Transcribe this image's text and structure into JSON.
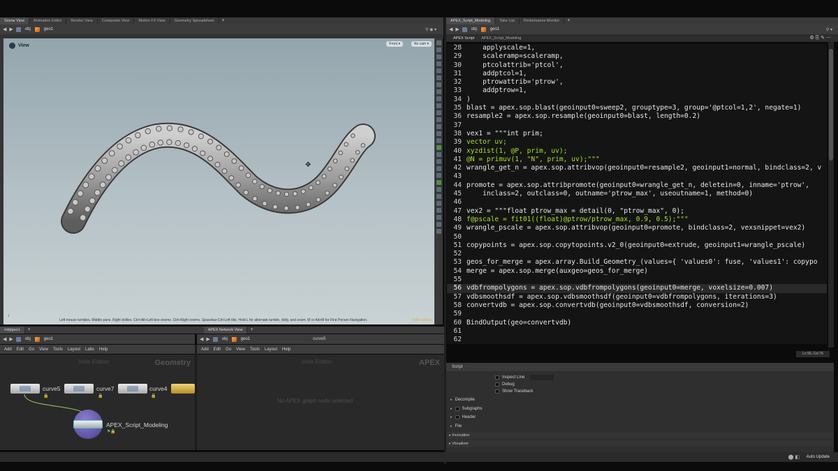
{
  "left_panes": {
    "tabs": [
      "Scene View",
      "Animation Editor",
      "Render View",
      "Composite View",
      "Motion FX View",
      "Geometry Spreadsheet"
    ],
    "path": [
      "obj",
      "geo1"
    ]
  },
  "viewport": {
    "title": "View",
    "persp": "Front",
    "cam": "No cam",
    "help": "Left mouse tumbles. Middle pans. Right dollies. Ctrl+Alt+Left box-zooms. Ctrl+Right zooms. Spacebar-Ctrl-Left tilts. Hold L for alternate tumble, dolly, and zoom. M or Alt+M for First Person Navigation.",
    "edition": "Indie Edition"
  },
  "right_panes": {
    "tabs": [
      "APEX_Script_Modeling",
      "Take List",
      "Performance Monitor"
    ],
    "path": [
      "obj",
      "geo1"
    ],
    "sub_tabs": [
      "APEX Script",
      "APEX_Script_Modeling"
    ],
    "cursor_pos": "Ln 56, Col 76"
  },
  "code": [
    {
      "n": "28",
      "t": "    applyscale=1,"
    },
    {
      "n": "29",
      "t": "    scaleramp=scaleramp,"
    },
    {
      "n": "30",
      "t": "    ptcolattrib='ptcol',"
    },
    {
      "n": "31",
      "t": "    addptcol=1,"
    },
    {
      "n": "32",
      "t": "    ptrowattrib='ptrow',"
    },
    {
      "n": "33",
      "t": "    addptrow=1,"
    },
    {
      "n": "34",
      "t": ")"
    },
    {
      "n": "35",
      "t": "blast = apex.sop.blast(geoinput0=sweep2, grouptype=3, group='@ptcol=1,2', negate=1)"
    },
    {
      "n": "36",
      "t": "resample2 = apex.sop.resample(geoinput0=blast, length=0.2)"
    },
    {
      "n": "37",
      "t": ""
    },
    {
      "n": "38",
      "t": "vex1 = \"\"\"int prim;"
    },
    {
      "n": "39",
      "t": "vector uv;"
    },
    {
      "n": "40",
      "t": "xyzdist(1, @P, prim, uv);"
    },
    {
      "n": "41",
      "t": "@N = primuv(1, \"N\", prim, uv);\"\"\""
    },
    {
      "n": "42",
      "t": "wrangle_get_n = apex.sop.attribvop(geoinput0=resample2, geoinput1=normal, bindclass=2, v"
    },
    {
      "n": "43",
      "t": ""
    },
    {
      "n": "44",
      "t": "promote = apex.sop.attribpromote(geoinput0=wrangle_get_n, deletein=0, inname='ptrow',"
    },
    {
      "n": "45",
      "t": "    inclass=2, outclass=0, outname='ptrow_max', useoutname=1, method=0)"
    },
    {
      "n": "46",
      "t": ""
    },
    {
      "n": "47",
      "t": "vex2 = \"\"\"float ptrow_max = detail(0, \"ptrow_max\", 0);"
    },
    {
      "n": "48",
      "t": "f@pscale = fit01((float)@ptrow/ptrow_max, 0.9, 0.5);\"\"\""
    },
    {
      "n": "49",
      "t": "wrangle_pscale = apex.sop.attribvop(geoinput0=promote, bindclass=2, vexsnippet=vex2)"
    },
    {
      "n": "50",
      "t": ""
    },
    {
      "n": "51",
      "t": "copypoints = apex.sop.copytopoints.v2_0(geoinput0=extrude, geoinput1=wrangle_pscale)"
    },
    {
      "n": "52",
      "t": ""
    },
    {
      "n": "53",
      "t": "geos_for_merge = apex.array.Build_Geometry_(values={ 'values0': fuse, 'values1': copypo"
    },
    {
      "n": "54",
      "t": "merge = apex.sop.merge(auxgeo=geos_for_merge)"
    },
    {
      "n": "55",
      "t": ""
    },
    {
      "n": "56",
      "t": "vdbfrompolygons = apex.sop.vdbfrompolygons(geoinput0=merge, voxelsize=0.007)"
    },
    {
      "n": "57",
      "t": "vdbsmoothsdf = apex.sop.vdbsmoothsdf(geoinput0=vdbfrompolygons, iterations=3)"
    },
    {
      "n": "58",
      "t": "convertvdb = apex.sop.convertvdb(geoinput0=vdbsmoothsdf, conversion=2)"
    },
    {
      "n": "59",
      "t": ""
    },
    {
      "n": "60",
      "t": "BindOutput(geo=convertvdb)"
    },
    {
      "n": "61",
      "t": ""
    },
    {
      "n": "62",
      "t": ""
    }
  ],
  "script_panel": {
    "header": "Script",
    "inspect_line": "Inspect Line",
    "debug": "Debug",
    "show_traceback": "Show Traceback",
    "sections": [
      "Decompile",
      "Subgraphs",
      "Header",
      "File"
    ],
    "invocation": "Invocation",
    "visualizer": "Visualizer"
  },
  "network": {
    "tabs": [
      "/obj/geo1",
      "APEX Network View"
    ],
    "path_left": [
      "obj",
      "geo1"
    ],
    "path_right": [
      "obj",
      "geo1"
    ],
    "right_node_field": "curve5",
    "menu_left": [
      "Add",
      "Edit",
      "Go",
      "View",
      "Tools",
      "Layout",
      "Labs",
      "Help"
    ],
    "menu_right": [
      "Add",
      "Edit",
      "Go",
      "View",
      "Tools",
      "Layout",
      "Help"
    ],
    "context_left": "Geometry",
    "context_right": "APEX",
    "edition": "Indie Edition",
    "empty_msg": "No APEX graph node selected",
    "nodes": [
      "curve5",
      "curve7",
      "curve4",
      "APEX_Script_Modeling"
    ]
  },
  "status": {
    "auto_update": "Auto Update"
  }
}
